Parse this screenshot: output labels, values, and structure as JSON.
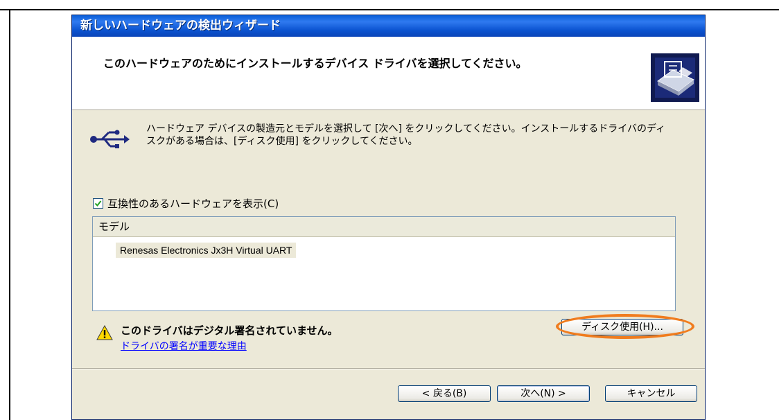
{
  "window": {
    "title": "新しいハードウェアの検出ウィザード"
  },
  "header": {
    "title": "このハードウェアのためにインストールするデバイス ドライバを選択してください。"
  },
  "info": {
    "text": "ハードウェア デバイスの製造元とモデルを選択して [次へ] をクリックしてください。インストールするドライバのディスクがある場合は、[ディスク使用] をクリックしてください。"
  },
  "checkbox": {
    "label": "互換性のあるハードウェアを表示(C)",
    "checked": true
  },
  "list": {
    "header": "モデル",
    "items": [
      "Renesas Electronics Jx3H Virtual UART"
    ]
  },
  "warning": {
    "text": "このドライバはデジタル署名されていません。",
    "link": "ドライバの署名が重要な理由"
  },
  "buttons": {
    "disk": "ディスク使用(H)...",
    "back": "< 戻る(B)",
    "next": "次へ(N) >",
    "cancel": "キャンセル"
  },
  "colors": {
    "titlebar": "#0a5fd8",
    "highlight": "#f07c1e",
    "dialog_bg": "#ece9d8"
  }
}
